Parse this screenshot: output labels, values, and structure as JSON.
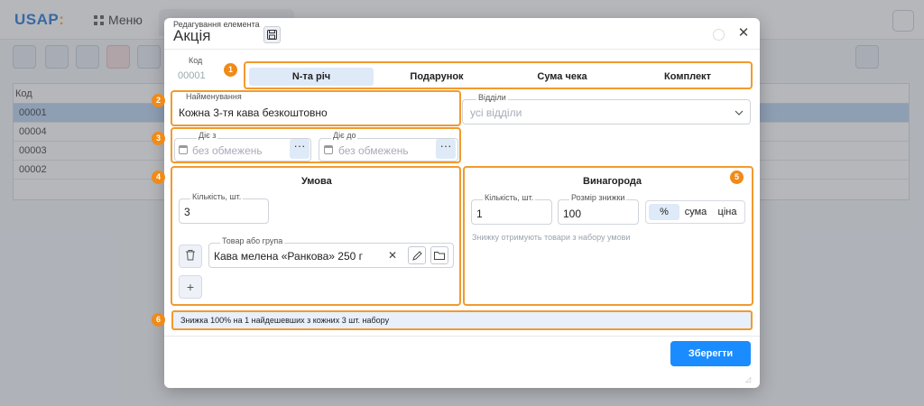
{
  "app": {
    "logo": "USAP",
    "logo_mark": ":",
    "menu_label": "Меню"
  },
  "grid": {
    "header": "Код",
    "rows": [
      "00001",
      "00004",
      "00003",
      "00002"
    ],
    "selected_index": 0
  },
  "dialog": {
    "subtitle": "Редагування елемента",
    "title": "Акція",
    "code_label": "Код",
    "code_value": "00001",
    "tabs": [
      "N-та річ",
      "Подарунок",
      "Сума чека",
      "Комплект"
    ],
    "active_tab": 0,
    "name_label": "Найменування",
    "name_value": "Кожна 3-тя кава безкоштовно",
    "dept_label": "Відділи",
    "dept_value": "усі відділи",
    "from_label": "Діє з",
    "from_placeholder": "без обмежень",
    "to_label": "Діє до",
    "to_placeholder": "без обмежень",
    "dots": "···",
    "condition": {
      "title": "Умова",
      "qty_label": "Кількість, шт.",
      "qty_value": "3",
      "product_label": "Товар або група",
      "product_value": "Кава мелена «Ранкова» 250 г",
      "add_label": "+"
    },
    "reward": {
      "title": "Винагорода",
      "qty_label": "Кількість, шт.",
      "qty_value": "1",
      "discount_label": "Розмір знижки",
      "discount_value": "100",
      "modes": [
        "%",
        "сума",
        "ціна"
      ],
      "active_mode": 0,
      "note": "Знижку отримують товари з набору умови"
    },
    "summary": "Знижка 100% на 1 найдешевших з кожних 3 шт. набору",
    "save_label": "Зберегти",
    "markers": [
      "1",
      "2",
      "3",
      "4",
      "5",
      "6"
    ]
  },
  "colors": {
    "accent": "#1a8cff",
    "marker": "#f08a18",
    "highlight": "#dfeaf8"
  }
}
